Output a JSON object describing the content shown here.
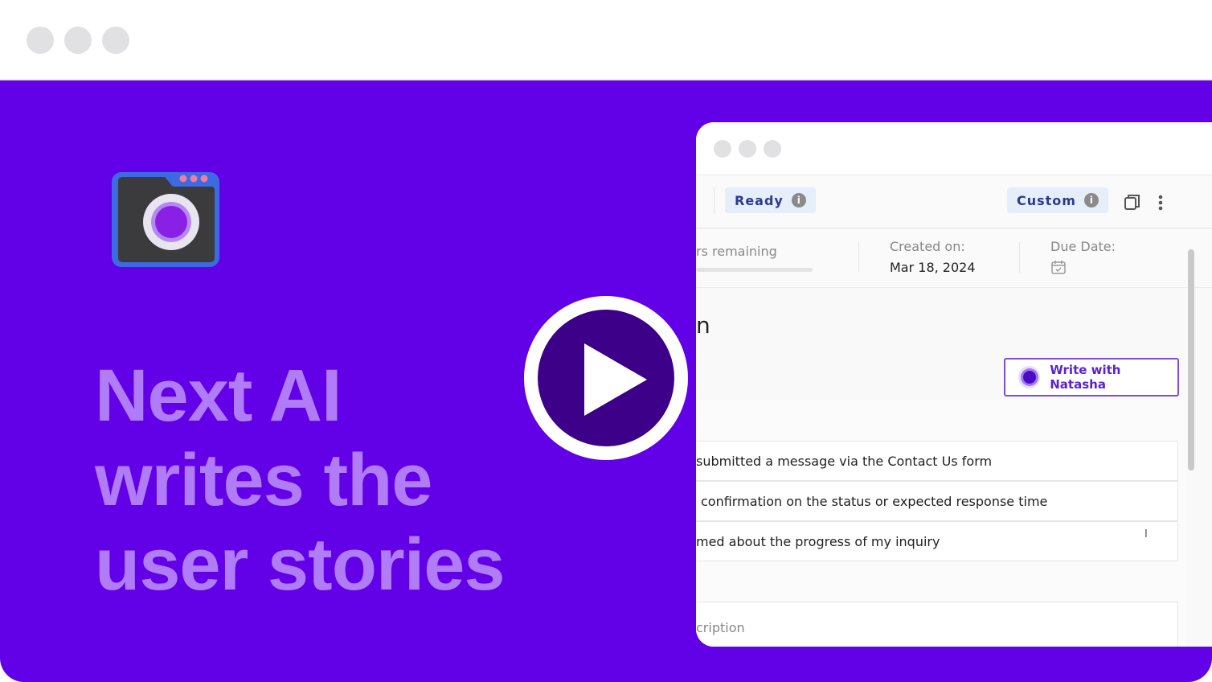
{
  "headline": {
    "line1": "Next AI",
    "line2": "writes the",
    "line3": "user stories"
  },
  "app_window": {
    "toolbar": {
      "status_label": "Ready",
      "type_label": "Custom"
    },
    "info": {
      "remaining_label": "rs remaining",
      "created_label": "Created on:",
      "created_value": "Mar 18, 2024",
      "due_label": "Due Date:"
    },
    "section_title_fragment": "n",
    "ai_button_label": "Write with Natasha",
    "story_rows": [
      "submitted a message via the Contact Us form",
      "confirmation on the status or expected response time",
      "med about the progress of my inquiry"
    ],
    "description_placeholder": "cription"
  },
  "colors": {
    "background": "#6200e8",
    "headline": "#b07cf8",
    "play": "#3d0088"
  }
}
